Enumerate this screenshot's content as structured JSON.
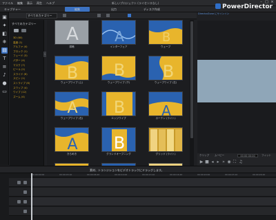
{
  "menubar": {
    "items": [
      "ファイル",
      "編集",
      "表示",
      "再生",
      "ヘルプ"
    ],
    "window_title": "新しいプロジェクト (ライセンスなし)"
  },
  "modes": {
    "capture": "キャプチャー",
    "edit": "編集",
    "produce": "出力",
    "disc": "ディスク作成"
  },
  "brand": {
    "name": "PowerDirector",
    "sublink": "DirectorZone にサインイン"
  },
  "library": {
    "dropdown": "すべてのカテゴリー",
    "category_header": "すべてのカテゴリー",
    "categories": [
      "3D (60)",
      "高度 (1)",
      "アルファ (4)",
      "ブロック (1)",
      "フェード (3)",
      "パター (4)",
      "マスク (7)",
      "ピール (2)",
      "スライド (6)",
      "スピン (1)",
      "ストライプ (6)",
      "スワップ (4)",
      "ワイプ (12)",
      "ズーム (4)"
    ]
  },
  "thumbnails": [
    {
      "caption": "溶暗",
      "style": "fade"
    },
    {
      "caption": "インターフェア",
      "style": "interfere"
    },
    {
      "caption": "ウェーブ",
      "style": "wave"
    },
    {
      "caption": "",
      "style": "empty"
    },
    {
      "caption": "ウェーブワイプ (上)",
      "style": "wwu"
    },
    {
      "caption": "ウェーブワイプ (下)",
      "style": "wwd"
    },
    {
      "caption": "ウェーブワイプ (左)",
      "style": "wwl"
    },
    {
      "caption": "",
      "style": "empty"
    },
    {
      "caption": "ウェーブワイプ (右)",
      "style": "wwr"
    },
    {
      "caption": "エッジワイプ",
      "style": "edge"
    },
    {
      "caption": "カーテン (ライト)",
      "style": "curtain"
    },
    {
      "caption": "",
      "style": "empty"
    },
    {
      "caption": "きらめき",
      "style": "sparkle"
    },
    {
      "caption": "グランドオープニング",
      "style": "grand"
    },
    {
      "caption": "グリッド (ライト)",
      "style": "grid"
    },
    {
      "caption": "",
      "style": "empty"
    },
    {
      "caption": "",
      "style": "partial"
    },
    {
      "caption": "",
      "style": "partial2"
    },
    {
      "caption": "",
      "style": "partial3"
    }
  ],
  "preview": {
    "modes": [
      "クリップ",
      "ムービー"
    ],
    "timecode": "00:00:00:00",
    "fit": "フィット"
  },
  "status": {
    "message": "素材、トランジションをビデオトラックにドラッグします。"
  },
  "timeline": {
    "ticks": [
      "00:00:00:00",
      "00:00:03:10",
      "00:00:06:20",
      "00:00:10:00",
      "00:00:13:10",
      "00:00:16:20",
      "00:00:20:00",
      "00:00:23:10",
      "00:00:26:20"
    ]
  },
  "colors": {
    "accent": "#3c72c2",
    "category_text": "#d3a521",
    "transition_gold": "#e8b52c",
    "transition_blue": "#2a62b0"
  }
}
